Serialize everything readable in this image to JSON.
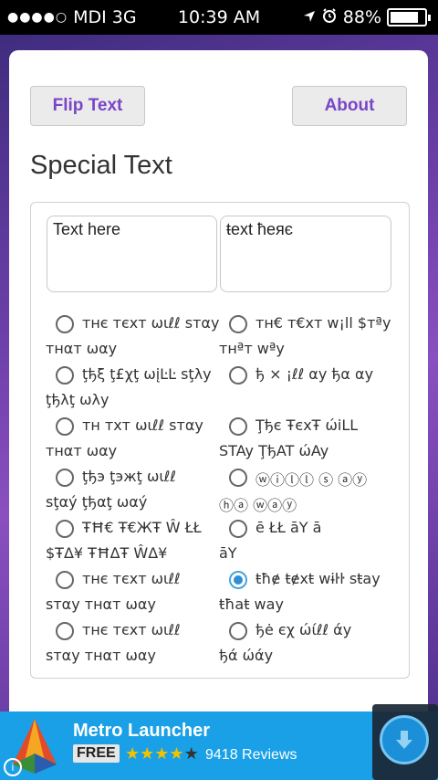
{
  "status": {
    "carrier": "MDI",
    "network": "3G",
    "time": "10:39 AM",
    "battery_text": "88%",
    "battery_level": 0.88,
    "signal_icon": "signal-dots-icon",
    "location_icon": "location-arrow-icon",
    "alarm_icon": "alarm-icon"
  },
  "header": {
    "flip_label": "Flip Text",
    "about_label": "About"
  },
  "main": {
    "title": "Special Text",
    "input_value": "Text here",
    "output_value": "ŧext ħeяє"
  },
  "options": [
    {
      "line1": "тнє тєхт ωιℓℓ ѕтαу",
      "line2": "тнαт ωαу",
      "checked": false
    },
    {
      "line1": "тн€ т€хт w¡ll $тªy",
      "line2": "тнªт wªy",
      "checked": false
    },
    {
      "line1": "ţђξ ţ£χţ ωįĿĿ ѕţλу",
      "line2": "ţђλţ ωλу",
      "checked": false
    },
    {
      "line1": "ђ  ×  ¡ℓℓ  αу ђα  αу",
      "line2": "",
      "checked": false
    },
    {
      "line1": "тн тxт ωιℓℓ ѕтαу",
      "line2": "тнαт ωαу",
      "checked": false
    },
    {
      "line1": "Ţђє ŦєxŦ ώiLL",
      "line2": "STAy ŢђAT ώAy",
      "checked": false
    },
    {
      "line1": "ţђэ ţэжţ ωιℓℓ",
      "line2": "ѕţαý ţђαţ ωαý",
      "checked": false
    },
    {
      "line1": "ⓦⓘⓛⓛ ⓢ ⓐⓨ",
      "line2": "ⓗⓐ ⓦⓐⓨ",
      "checked": false
    },
    {
      "line1": "ŦĦ€ Ŧ€ЖŦ Ŵ ŁŁ",
      "line2": "$ŦΔ¥ ŦĦΔŦ ŴΔ¥",
      "checked": false
    },
    {
      "line1": "ē   ŁŁ  āY  ā",
      "line2": "āY",
      "checked": false
    },
    {
      "line1": "тнє тєxт ωιℓℓ",
      "line2": "ѕтαу тнαт ωαу",
      "checked": false
    },
    {
      "line1": "ŧħɇ ŧɇxŧ wɨŀŀ sŧay",
      "line2": "ŧħaŧ way",
      "checked": true
    },
    {
      "line1": "тнє тєxт ωιℓℓ",
      "line2": "ѕтαу тнαт ωαу",
      "checked": false
    },
    {
      "line1": "ђė єχ ώίℓℓ άу",
      "line2": "ђά ώάу",
      "checked": false
    }
  ],
  "ad": {
    "name": "Metro Launcher",
    "price": "FREE",
    "rating": 4,
    "rating_max": 5,
    "reviews": "9418 Reviews",
    "download_icon": "download-icon",
    "info_icon": "info-icon",
    "logo_icon": "app-logo-icon"
  }
}
